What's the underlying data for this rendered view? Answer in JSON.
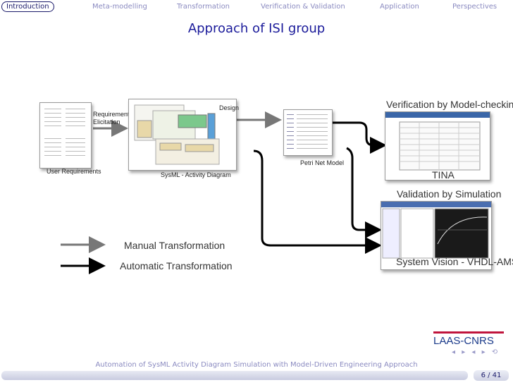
{
  "nav": {
    "items": [
      "Introduction",
      "Meta-modelling",
      "Transformation",
      "Verification & Validation",
      "Application",
      "Perspectives"
    ]
  },
  "title": "Approach of ISI group",
  "diagram": {
    "user_req_label": "User Requirements",
    "req_elicit": [
      "Requirements",
      "Elicitation"
    ],
    "design_label": "Design",
    "sysml_label": "SysML - Activity Diagram",
    "petri_label": "Petri Net Model",
    "verif_title": "Verification by Model-checking",
    "tina_label": "TINA",
    "valid_title": "Validation by Simulation",
    "sysvision_label": "System Vision - VHDL-AMS",
    "legend_manual": "Manual Transformation",
    "legend_auto": "Automatic Transformation"
  },
  "logo": {
    "text": "LAAS-CNRS"
  },
  "footer": {
    "text": "Automation of SysML Activity Diagram Simulation with Model-Driven Engineering Approach",
    "page": "6 / 41"
  },
  "colors": {
    "title": "#1a1a9a",
    "nav_inactive": "#8a8ac0",
    "logo_red": "#c0143c"
  }
}
